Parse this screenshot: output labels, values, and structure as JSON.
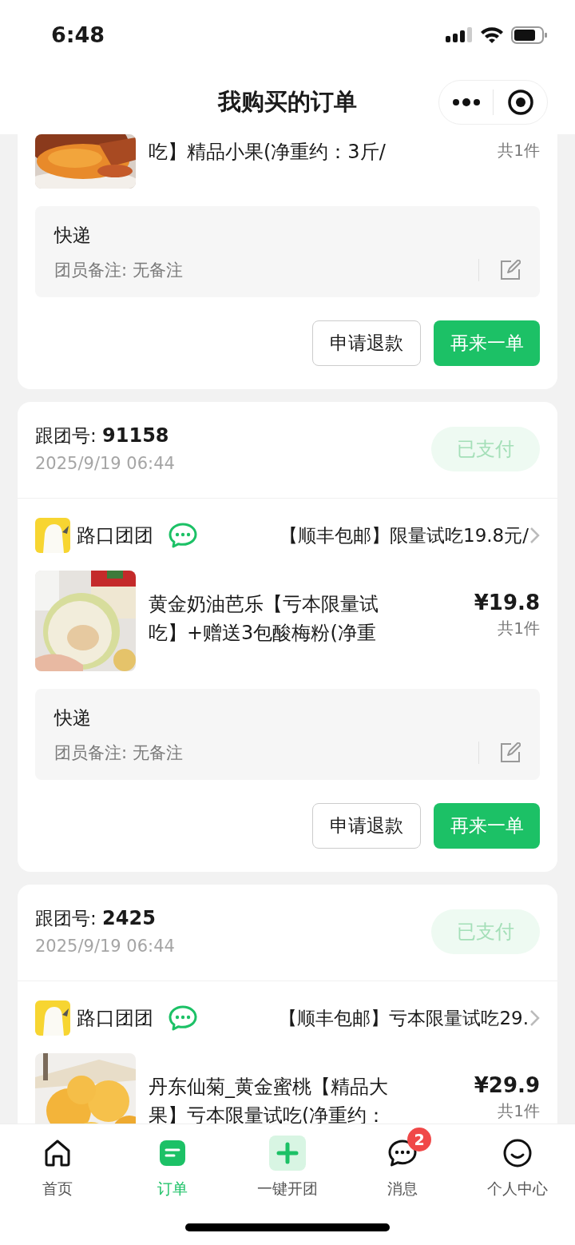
{
  "status_bar": {
    "time": "6:48"
  },
  "nav": {
    "title": "我购买的订单"
  },
  "orders": [
    {
      "items": [
        {
          "name": "吃】精品小果(净重约：3斤/",
          "count": "共1件"
        }
      ],
      "delivery": "快递",
      "remark": "团员备注: 无备注",
      "buttons": [
        "申请退款",
        "再来一单"
      ]
    },
    {
      "group_no_label": "跟团号:",
      "group_no": "91158",
      "date": "2025/9/19 06:44",
      "status": "已支付",
      "shop": {
        "name": "路口团团",
        "title": "【顺丰包邮】限量试吃19.8元/"
      },
      "items": [
        {
          "name": "黄金奶油芭乐【亏本限量试吃】+赠送3包酸梅粉(净重",
          "price": "¥19.8",
          "count": "共1件"
        }
      ],
      "delivery": "快递",
      "remark": "团员备注: 无备注",
      "buttons": [
        "申请退款",
        "再来一单"
      ]
    },
    {
      "group_no_label": "跟团号:",
      "group_no": "2425",
      "date": "2025/9/19 06:44",
      "status": "已支付",
      "shop": {
        "name": "路口团团",
        "title": "【顺丰包邮】亏本限量试吃29."
      },
      "items": [
        {
          "name": "丹东仙菊_黄金蜜桃【精品大果】亏本限量试吃(净重约：",
          "price": "¥29.9",
          "count": "共1件"
        }
      ]
    }
  ],
  "tabs": [
    {
      "label": "首页",
      "selected": false
    },
    {
      "label": "订单",
      "selected": true
    },
    {
      "label": "一键开团",
      "selected": false
    },
    {
      "label": "消息",
      "selected": false,
      "badge": "2"
    },
    {
      "label": "个人中心",
      "selected": false
    }
  ]
}
